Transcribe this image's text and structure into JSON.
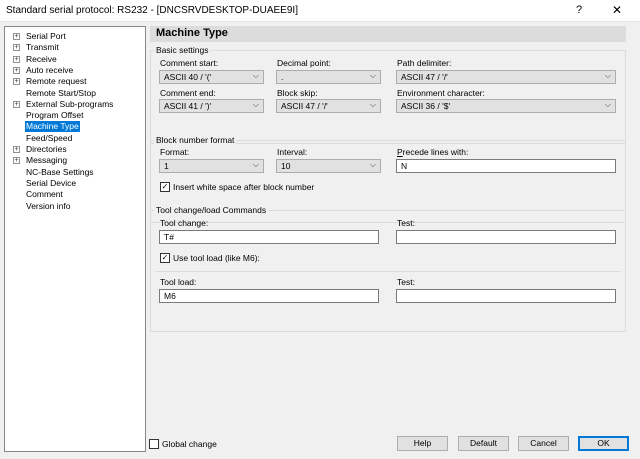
{
  "window": {
    "title": "Standard serial protocol: RS232 - [DNCSRVDESKTOP-DUAEE9I]",
    "help_glyph": "?",
    "close_glyph": "✕"
  },
  "tree": {
    "items": [
      {
        "label": "Serial Port",
        "expander": "+"
      },
      {
        "label": "Transmit",
        "expander": "+"
      },
      {
        "label": "Receive",
        "expander": "+"
      },
      {
        "label": "Auto receive",
        "expander": "+"
      },
      {
        "label": "Remote request",
        "expander": "+"
      },
      {
        "label": "Remote Start/Stop",
        "expander": ""
      },
      {
        "label": "External Sub-programs",
        "expander": "+"
      },
      {
        "label": "Program Offset",
        "expander": ""
      },
      {
        "label": "Machine Type",
        "expander": "",
        "selected": true
      },
      {
        "label": "Feed/Speed",
        "expander": ""
      },
      {
        "label": "Directories",
        "expander": "+"
      },
      {
        "label": "Messaging",
        "expander": "+"
      },
      {
        "label": "NC-Base Settings",
        "expander": ""
      },
      {
        "label": "Serial Device",
        "expander": ""
      },
      {
        "label": "Comment",
        "expander": ""
      },
      {
        "label": "Version info",
        "expander": ""
      }
    ]
  },
  "header": {
    "title": "Machine Type"
  },
  "basic": {
    "title": "Basic settings",
    "comment_start": {
      "label": "Comment start:",
      "value": "ASCII 40 / '('"
    },
    "decimal_point": {
      "label": "Decimal point:",
      "value": "."
    },
    "path_delimiter": {
      "label": "Path delimiter:",
      "value": "ASCII 47 / '/'"
    },
    "comment_end": {
      "label": "Comment end:",
      "value": "ASCII 41 / ')'"
    },
    "block_skip": {
      "label": "Block skip:",
      "value": "ASCII 47 / '/'"
    },
    "env_char": {
      "label": "Environment character:",
      "value": "ASCII 36 / '$'"
    }
  },
  "block": {
    "title": "Block number format",
    "format": {
      "label": "Format:",
      "value": "1"
    },
    "interval": {
      "label": "Interval:",
      "value": "10"
    },
    "precede": {
      "label_first": "P",
      "label_rest": "recede lines with:",
      "value": "N"
    },
    "whitespace": {
      "label": "Insert white space after block number",
      "checked": true,
      "mark": "✓"
    }
  },
  "tool": {
    "title": "Tool change/load Commands",
    "change": {
      "label": "Tool change:",
      "value": "T#"
    },
    "change_test": {
      "label": "Test:",
      "value": ""
    },
    "use_load": {
      "label": "Use tool load (like M6):",
      "checked": true,
      "mark": "✓"
    },
    "load": {
      "label": "Tool load:",
      "value": "M6"
    },
    "load_test": {
      "label": "Test:",
      "value": ""
    }
  },
  "footer": {
    "global_change": {
      "label": "Global change",
      "checked": false
    },
    "help": "Help",
    "default": "Default",
    "cancel": "Cancel",
    "ok": "OK"
  },
  "colors": {
    "selection": "#0078d7",
    "dialog_bg": "#f0f0f0",
    "header_bg": "#dcdcdc"
  }
}
